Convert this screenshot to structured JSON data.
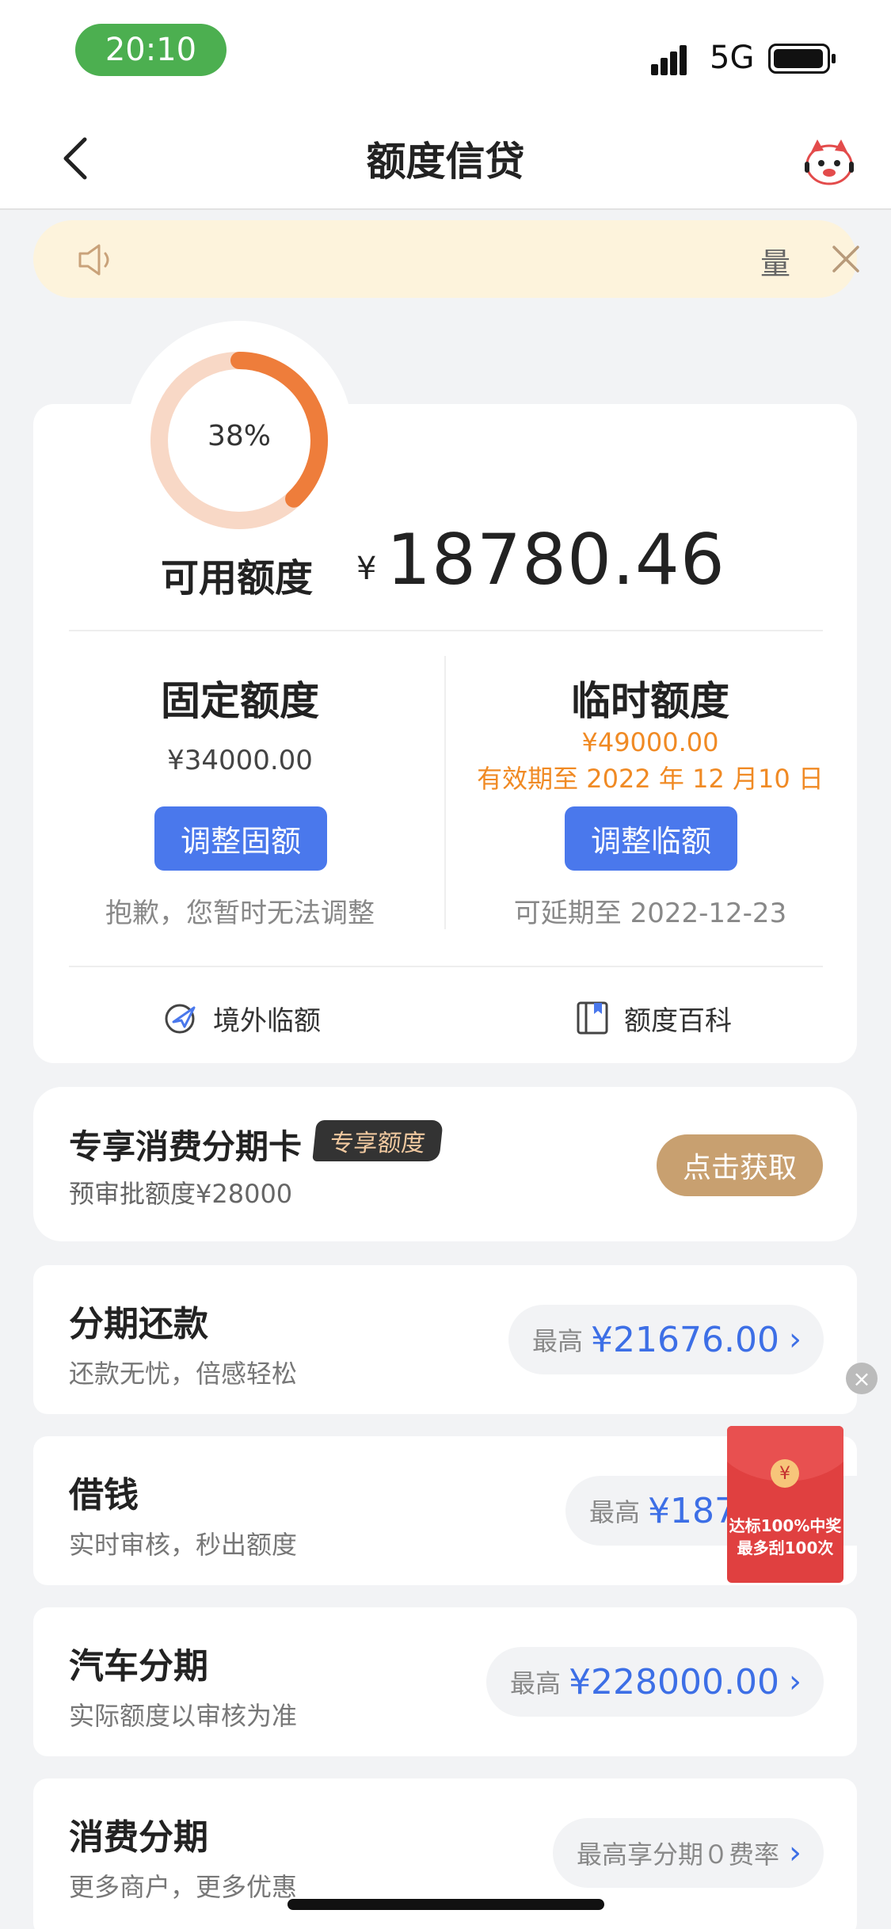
{
  "status_bar": {
    "time": "20:10",
    "network": "5G"
  },
  "nav": {
    "title": "额度信贷"
  },
  "notice": {
    "text": "量"
  },
  "credit": {
    "usage_percent_label": "38%",
    "usage_fraction": 0.38,
    "available_label": "可用额度",
    "currency": "¥",
    "available_amount": "18780.46",
    "fixed": {
      "title": "固定额度",
      "amount": "¥34000.00",
      "button": "调整固额",
      "note": "抱歉，您暂时无法调整"
    },
    "temporary": {
      "title": "临时额度",
      "amount": "¥49000.00",
      "expire": "有效期至 2022 年 12 月10 日",
      "button": "调整临额",
      "note": "可延期至 2022-12-23"
    },
    "links": {
      "abroad": "境外临额",
      "wiki": "额度百科"
    }
  },
  "exclusive": {
    "title": "专享消费分期卡",
    "badge": "专享额度",
    "subtitle": "预审批额度¥28000",
    "button": "点击获取"
  },
  "products": [
    {
      "title": "分期还款",
      "subtitle": "还款无忧，倍感轻松",
      "pre": "最高",
      "amount": "¥21676.00"
    },
    {
      "title": "借钱",
      "subtitle": "实时审核，秒出额度",
      "pre": "最高",
      "amount": "¥187"
    },
    {
      "title": "汽车分期",
      "subtitle": "实际额度以审核为准",
      "pre": "最高",
      "amount": "¥228000.00"
    },
    {
      "title": "消费分期",
      "subtitle": "更多商户，更多优惠",
      "text": "最高享分期０费率"
    }
  ],
  "float_ad": {
    "coin": "¥",
    "line1": "达标100%中奖",
    "line2": "最多刮100次"
  },
  "colors": {
    "accent_blue": "#4a78ec",
    "orange": "#f08a24",
    "gold": "#c8a070",
    "donut": "#ee7d3b"
  }
}
